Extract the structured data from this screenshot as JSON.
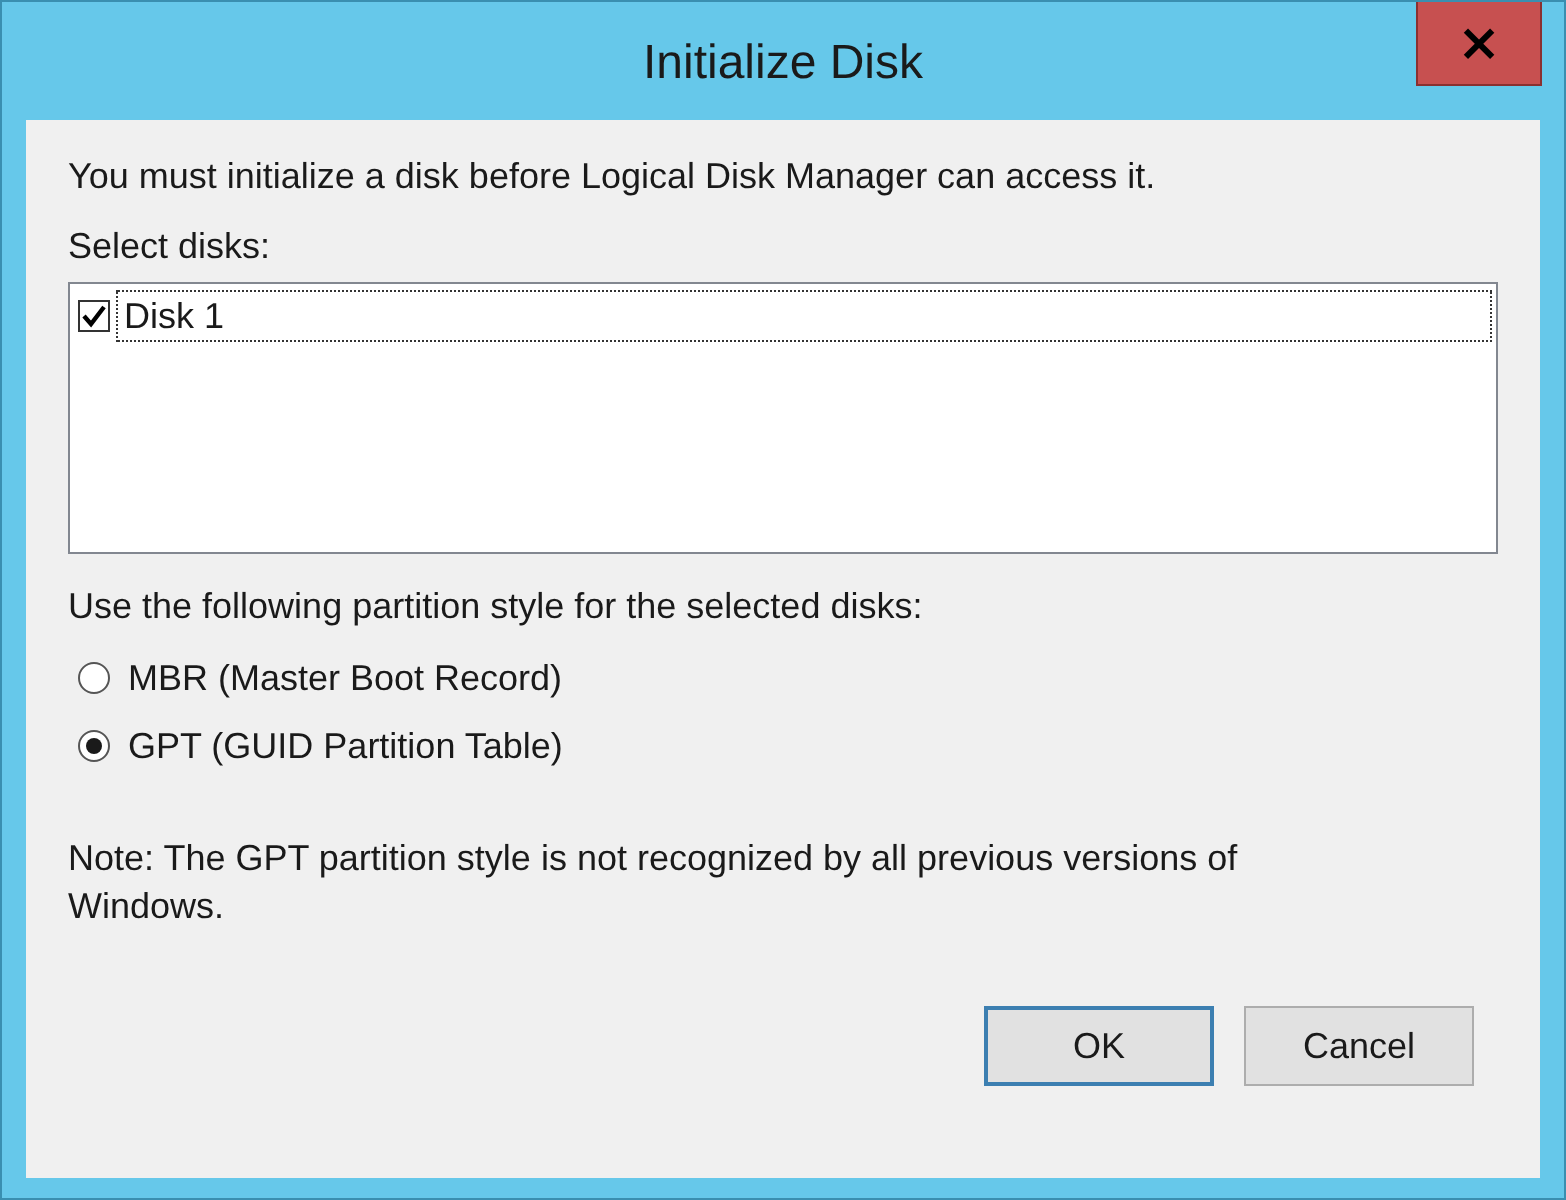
{
  "window": {
    "title": "Initialize Disk",
    "close": "×"
  },
  "intro": "You must initialize a disk before Logical Disk Manager can access it.",
  "disks_label": "Select disks:",
  "disks": [
    {
      "name": "Disk 1",
      "checked": true,
      "selected": true
    }
  ],
  "style_label": "Use the following partition style for the selected disks:",
  "styles": [
    {
      "label": "MBR (Master Boot Record)",
      "selected": false
    },
    {
      "label": "GPT (GUID Partition Table)",
      "selected": true
    }
  ],
  "note": "Note: The GPT partition style is not recognized by all previous versions of Windows.",
  "buttons": [
    {
      "label": "OK",
      "default": true
    },
    {
      "label": "Cancel",
      "default": false
    }
  ]
}
